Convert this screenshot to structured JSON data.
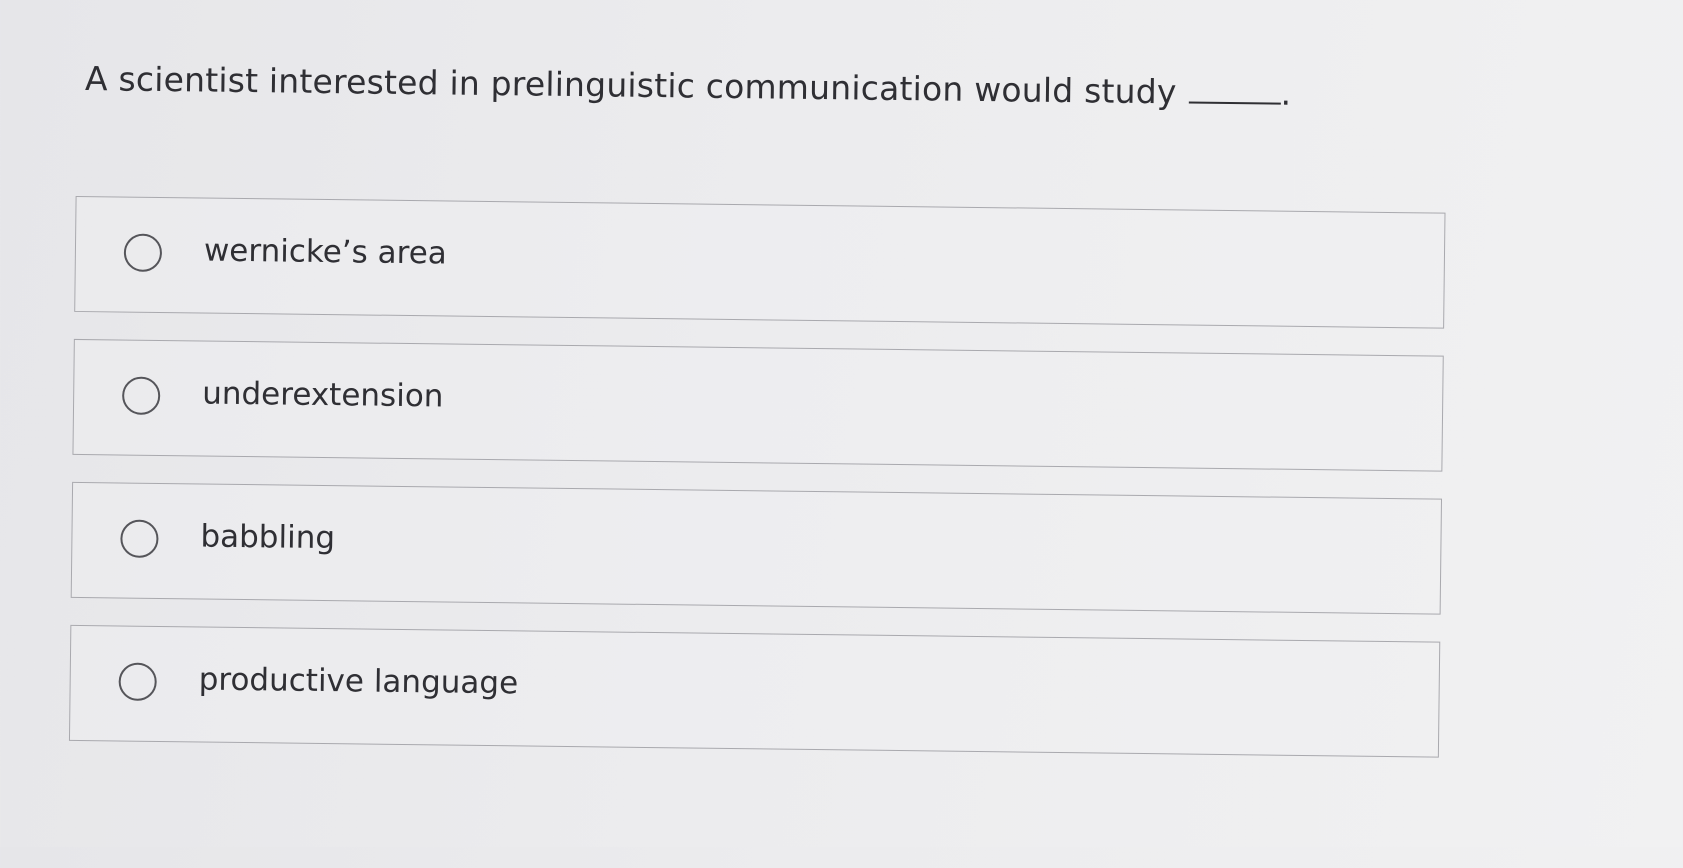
{
  "question": {
    "text": "A scientist interested in prelinguistic communication would study",
    "trailing_punctuation": "."
  },
  "options": [
    {
      "label": "wernicke’s area",
      "selected": false
    },
    {
      "label": "underextension",
      "selected": false
    },
    {
      "label": "babbling",
      "selected": false
    },
    {
      "label": "productive language",
      "selected": false
    }
  ]
}
